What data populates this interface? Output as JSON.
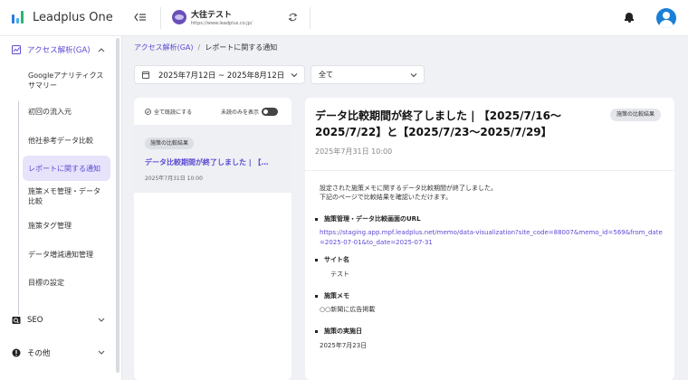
{
  "app": {
    "name": "Leadplus One"
  },
  "header": {
    "site_name": "大往テスト",
    "site_url": "https://www.leadplus.co.jp/"
  },
  "sidebar": {
    "sections": [
      {
        "label": "アクセス解析(GA)",
        "expanded": true
      },
      {
        "label": "SEO",
        "expanded": false
      },
      {
        "label": "その他",
        "expanded": false
      }
    ],
    "items": [
      {
        "label": "Googleアナリティクスサマリー"
      },
      {
        "label": "初回の流入元"
      },
      {
        "label": "他社参考データ比較"
      },
      {
        "label": "レポートに関する通知",
        "active": true
      },
      {
        "label": "施策メモ管理・データ比較"
      },
      {
        "label": "施策タグ管理"
      },
      {
        "label": "データ増減通知管理"
      },
      {
        "label": "目標の設定"
      }
    ]
  },
  "breadcrumb": {
    "parent": "アクセス解析(GA)",
    "separator": "/",
    "current": "レポートに関する通知"
  },
  "filters": {
    "date_range": "2025年7月12日  ~  2025年8月12日",
    "category": "全て"
  },
  "list": {
    "mark_all_read": "全て既読にする",
    "unread_only": "未読のみを表示",
    "items": [
      {
        "tag": "施策の比較結果",
        "title": "データ比較期間が終了しました | 【…",
        "date": "2025年7月31日 10:00"
      }
    ]
  },
  "detail": {
    "title": "データ比較期間が終了しました | 【2025/7/16〜2025/7/22】と【2025/7/23〜2025/7/29】",
    "badge": "施策の比較結果",
    "date": "2025年7月31日 10:00",
    "intro_1": "設定された施策メモに関するデータ比較期間が終了しました。",
    "intro_2": "下記のページで比較結果を確認いただけます。",
    "sections": [
      {
        "title": "施策管理・データ比較画面のURL",
        "value": "https://staging.app.mpf.leadplus.net/memo/data-visualization?site_code=88007&memo_id=569&from_date=2025-07-01&to_date=2025-07-31"
      },
      {
        "title": "サイト名",
        "value": "テスト"
      },
      {
        "title": "施策メモ",
        "value": "○○新聞に広告掲載"
      },
      {
        "title": "施策の実施日",
        "value": "2025年7月23日"
      }
    ]
  },
  "colors": {
    "accent": "#5b4bd3",
    "active_bg": "#e6e3fb",
    "avatar": "#1a7fd6"
  },
  "icons": [
    "leadplus-logo-icon",
    "menu-collapse-icon",
    "site-avatar-icon",
    "refresh-icon",
    "bell-icon",
    "user-icon",
    "analytics-icon",
    "seo-icon",
    "other-icon",
    "chevron-up-icon",
    "chevron-down-icon",
    "calendar-icon",
    "check-icon"
  ]
}
